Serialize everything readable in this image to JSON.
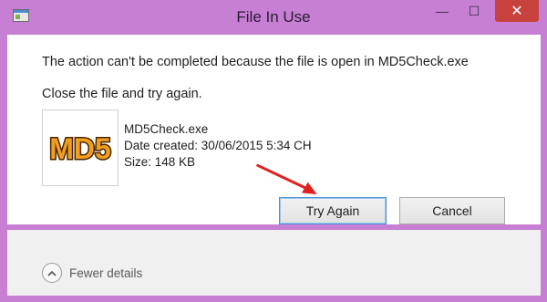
{
  "window": {
    "title": "File In Use",
    "controls": {
      "minimize": "—",
      "maximize": "☐",
      "close": "✕"
    },
    "colors": {
      "frame": "#c77fd4",
      "close": "#c8423d"
    }
  },
  "message": {
    "line1": "The action can't be completed because the file is open in MD5Check.exe",
    "line2": "Close the file and try again."
  },
  "file": {
    "icon_text": "MD5",
    "name": "MD5Check.exe",
    "date_created": "Date created: 30/06/2015 5:34 CH",
    "size": "Size: 148 KB"
  },
  "buttons": {
    "try_again": "Try Again",
    "cancel": "Cancel"
  },
  "footer": {
    "details_toggle": "Fewer details",
    "toggle_icon": "chevron-up-icon"
  }
}
